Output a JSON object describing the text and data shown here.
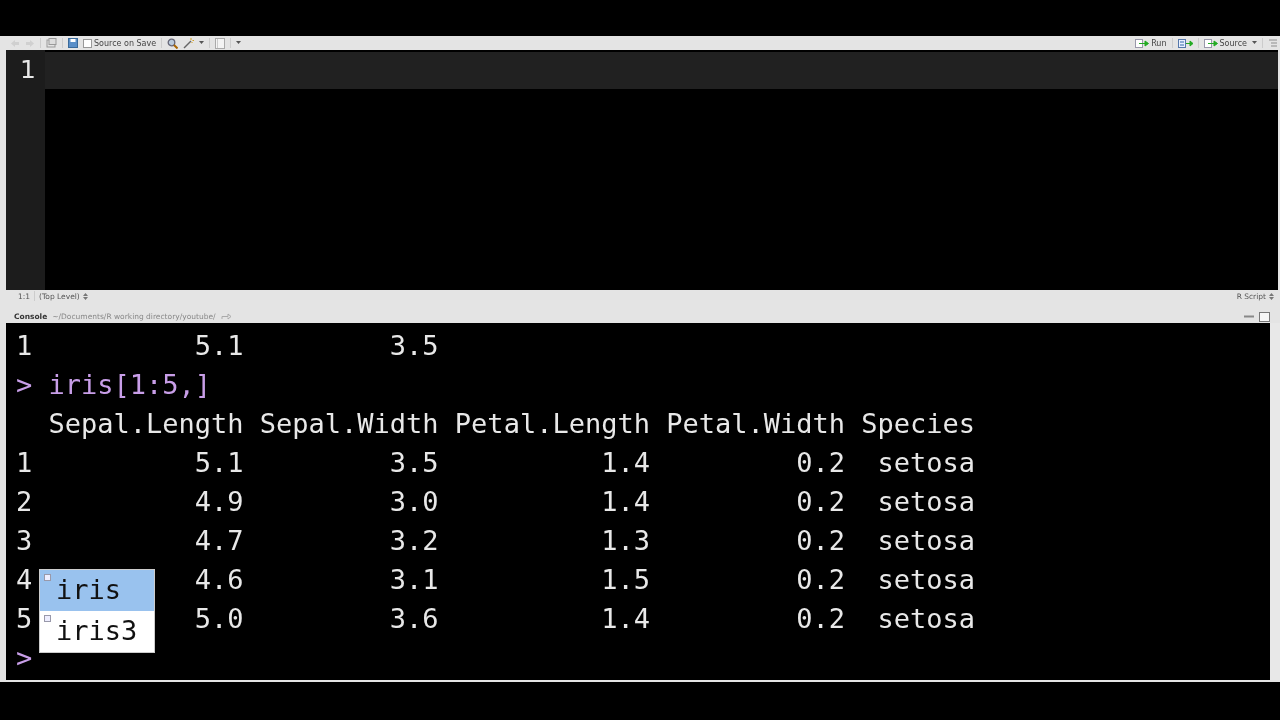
{
  "editor": {
    "toolbar": {
      "source_on_save": {
        "label": "Source on Save",
        "checked": false
      },
      "run_label": "Run",
      "source_label": "Source"
    },
    "line_numbers": [
      "1"
    ],
    "status": {
      "position": "1:1",
      "scope": "(Top Level)",
      "file_type": "R Script"
    }
  },
  "console": {
    "title": "Console",
    "path": "~/Documents/R working directory/youtube/",
    "lines": [
      {
        "kind": "row",
        "cells": [
          "1",
          "5.1",
          "3.5"
        ]
      },
      {
        "kind": "input",
        "prompt": ">",
        "text": "iris[1:5,]"
      },
      {
        "kind": "header",
        "cells": [
          "Sepal.Length",
          "Sepal.Width",
          "Petal.Length",
          "Petal.Width",
          "Species"
        ]
      },
      {
        "kind": "row",
        "cells": [
          "1",
          "5.1",
          "3.5",
          "1.4",
          "0.2",
          "setosa"
        ]
      },
      {
        "kind": "row",
        "cells": [
          "2",
          "4.9",
          "3.0",
          "1.4",
          "0.2",
          "setosa"
        ]
      },
      {
        "kind": "row",
        "cells": [
          "3",
          "4.7",
          "3.2",
          "1.3",
          "0.2",
          "setosa"
        ]
      },
      {
        "kind": "row",
        "cells": [
          "4",
          "4.6",
          "3.1",
          "1.5",
          "0.2",
          "setosa"
        ]
      },
      {
        "kind": "row",
        "cells": [
          "5",
          "5.0",
          "3.6",
          "1.4",
          "0.2",
          "setosa"
        ]
      },
      {
        "kind": "input",
        "prompt": ">"
      }
    ],
    "completions": [
      {
        "label": "iris",
        "selected": true
      },
      {
        "label": "iris3",
        "selected": false
      }
    ]
  }
}
